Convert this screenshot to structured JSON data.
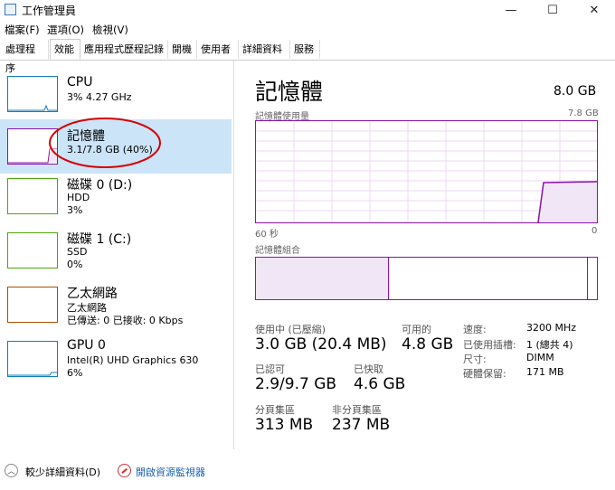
{
  "window": {
    "title": "工作管理員",
    "minimize": "—",
    "maximize": "☐",
    "close": "✕"
  },
  "menu": [
    "檔案(F)",
    "選項(O)",
    "檢視(V)"
  ],
  "tabs": [
    "處理程序",
    "效能",
    "應用程式歷程記錄",
    "開機",
    "使用者",
    "詳細資料",
    "服務"
  ],
  "active_tab": "效能",
  "resources": [
    {
      "name": "CPU",
      "line1": "3% 4.27 GHz",
      "line2": "",
      "color": "#117dbb"
    },
    {
      "name": "記憶體",
      "line1": "3.1/7.8 GB (40%)",
      "line2": "",
      "color": "#8b12ae"
    },
    {
      "name": "磁碟 0 (D:)",
      "line1": "HDD",
      "line2": "3%",
      "color": "#4da60c"
    },
    {
      "name": "磁碟 1 (C:)",
      "line1": "SSD",
      "line2": "0%",
      "color": "#4da60c"
    },
    {
      "name": "乙太網路",
      "line1": "乙太網路",
      "line2": "已傳送: 0 已接收: 0 Kbps",
      "color": "#a74f01"
    },
    {
      "name": "GPU 0",
      "line1": "Intel(R) UHD Graphics 630",
      "line2": "6%",
      "color": "#117dbb"
    }
  ],
  "detail": {
    "title": "記憶體",
    "total": "8.0 GB",
    "usage_label": "記憶體使用量",
    "usage_max": "7.8 GB",
    "axis_left": "60 秒",
    "axis_right": "0",
    "composition_label": "記憶體組合",
    "usage_fraction": 0.4,
    "stats": {
      "in_use_label": "使用中 (已壓縮)",
      "in_use_value": "3.0 GB (20.4 MB)",
      "available_label": "可用的",
      "available_value": "4.8 GB",
      "committed_label": "已認可",
      "committed_value": "2.9/9.7 GB",
      "cached_label": "已快取",
      "cached_value": "4.6 GB",
      "paged_label": "分頁集區",
      "paged_value": "313 MB",
      "nonpaged_label": "非分頁集區",
      "nonpaged_value": "237 MB"
    },
    "specs": {
      "speed_label": "速度:",
      "speed_value": "3200 MHz",
      "slots_label": "已使用插槽:",
      "slots_value": "1 (總共 4)",
      "form_label": "尺寸:",
      "form_value": "DIMM",
      "reserved_label": "硬體保留:",
      "reserved_value": "171 MB"
    }
  },
  "footer": {
    "fewer_details": "較少詳細資料(D)",
    "open_monitor": "開啟資源監視器"
  },
  "colors": {
    "memory_purple": "#8b12ae",
    "highlight_red": "#d40000",
    "selection": "#cce4f7",
    "link": "#1a5fb4"
  }
}
